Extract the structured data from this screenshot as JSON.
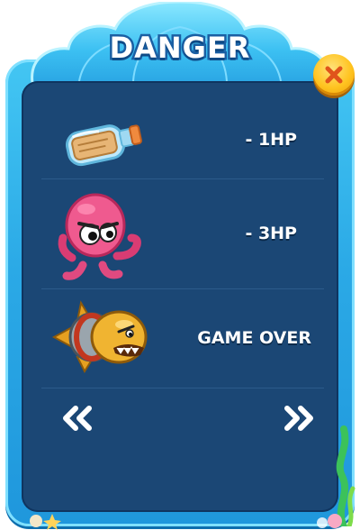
{
  "dialog": {
    "title": "DANGER",
    "close_icon": "close-x-icon"
  },
  "rows": [
    {
      "icon": "message-bottle-icon",
      "label": "- 1HP"
    },
    {
      "icon": "pink-octopus-icon",
      "label": "- 3HP"
    },
    {
      "icon": "armored-piranha-fish-icon",
      "label": "GAME OVER"
    }
  ],
  "navigation": {
    "prev": "double-chevron-left-icon",
    "next": "double-chevron-right-icon"
  },
  "colors": {
    "frame": "#2ba9e6",
    "panel": "#1b4775",
    "title_outline": "#1a5fa3",
    "close_button": "#ffc31f",
    "close_x": "#e0541b"
  }
}
